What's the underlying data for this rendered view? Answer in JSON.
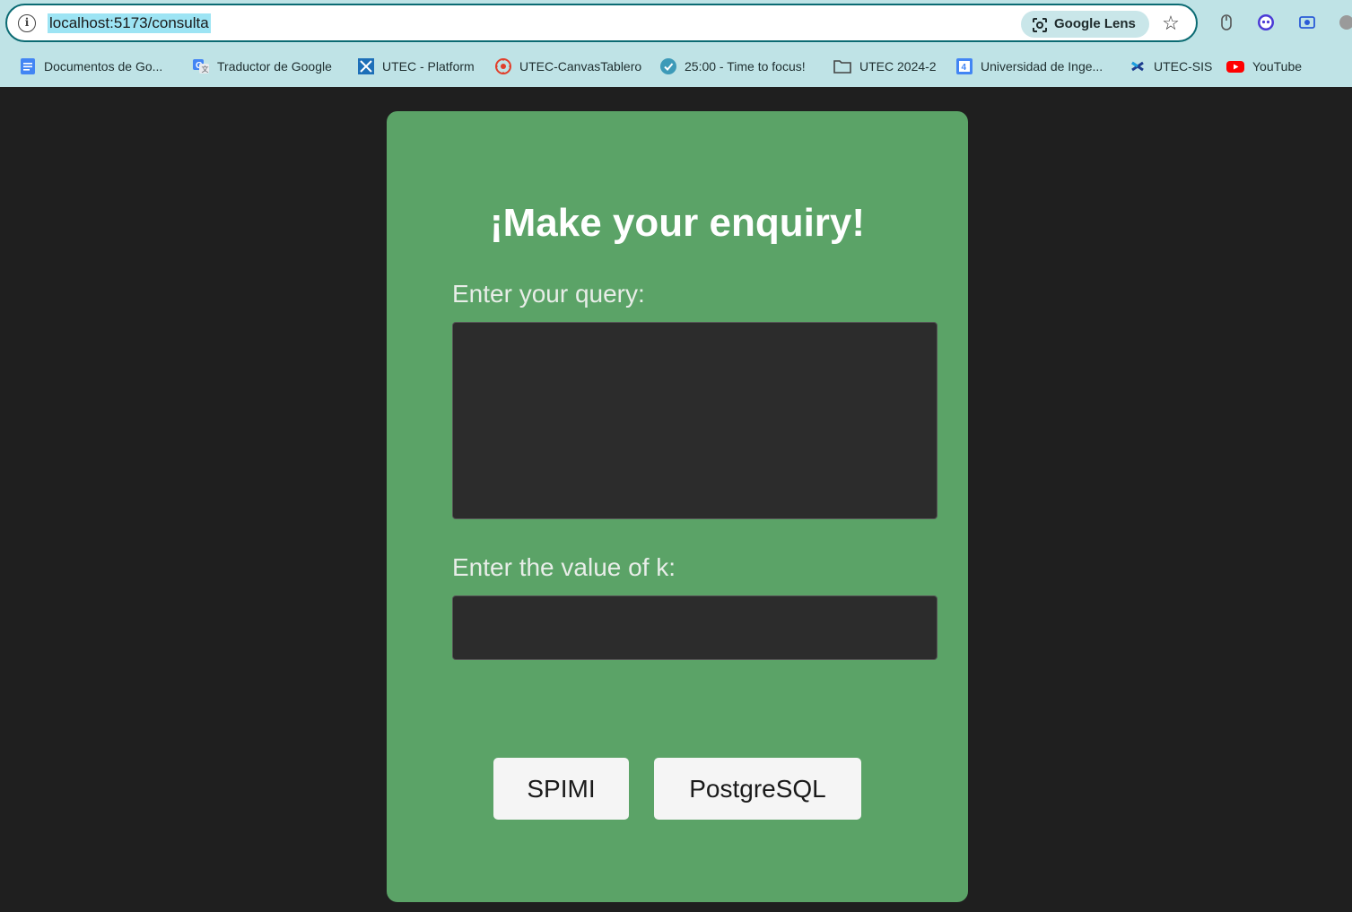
{
  "browser": {
    "url": "localhost:5173/consulta",
    "lens_label": "Google Lens",
    "bookmarks": [
      {
        "label": "Documentos de Go...",
        "icon": "google-docs-icon"
      },
      {
        "label": "Traductor de Google",
        "icon": "google-translate-icon"
      },
      {
        "label": "UTEC - Platform",
        "icon": "utec-platform-icon"
      },
      {
        "label": "UTEC-CanvasTablero",
        "icon": "canvas-icon"
      },
      {
        "label": "25:00 - Time to focus!",
        "icon": "check-circle-icon"
      },
      {
        "label": "UTEC 2024-2",
        "icon": "folder-icon"
      },
      {
        "label": "Universidad de Inge...",
        "icon": "google-calendar-icon"
      },
      {
        "label": "UTEC-SIS",
        "icon": "utec-sis-icon"
      },
      {
        "label": "YouTube",
        "icon": "youtube-icon"
      }
    ]
  },
  "form": {
    "title": "¡Make your enquiry!",
    "query_label": "Enter your query:",
    "query_value": "",
    "k_label": "Enter the value of k:",
    "k_value": "",
    "buttons": [
      "SPIMI",
      "PostgreSQL"
    ]
  },
  "colors": {
    "card": "#5ba367",
    "page_bg": "#1f1f1f",
    "input_bg": "#2c2c2c",
    "toolbar_bg": "#bfe3e6"
  }
}
